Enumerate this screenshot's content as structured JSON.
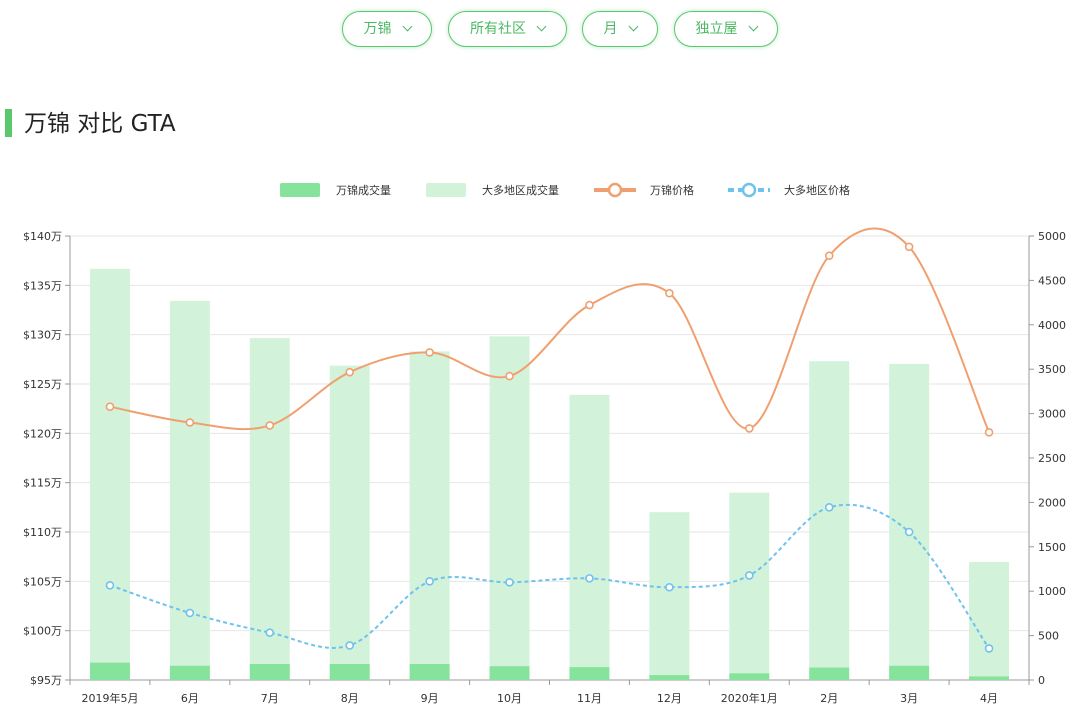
{
  "filters": [
    {
      "label": "万锦"
    },
    {
      "label": "所有社区"
    },
    {
      "label": "月"
    },
    {
      "label": "独立屋"
    }
  ],
  "section_title": "万锦 对比 GTA",
  "colors": {
    "bar_local": "#86e39b",
    "bar_gta": "#d3f2da",
    "line_local": "#f0a070",
    "line_gta": "#6ec2ee",
    "accent": "#5cc86e"
  },
  "chart_data": {
    "type": "bar",
    "categories": [
      "2019年5月",
      "6月",
      "7月",
      "8月",
      "9月",
      "10月",
      "11月",
      "12月",
      "2020年1月",
      "2月",
      "3月",
      "4月"
    ],
    "series": [
      {
        "name": "万锦成交量",
        "type": "bar",
        "axis": "right",
        "values": [
          195,
          160,
          180,
          180,
          180,
          155,
          145,
          55,
          75,
          140,
          160,
          40
        ]
      },
      {
        "name": "大多地区成交量",
        "type": "bar",
        "axis": "right",
        "values": [
          4630,
          4270,
          3850,
          3540,
          3700,
          3870,
          3210,
          1890,
          2110,
          3590,
          3560,
          1330
        ]
      },
      {
        "name": "万锦价格",
        "type": "line",
        "axis": "left",
        "values": [
          122.7,
          121.1,
          120.8,
          126.2,
          128.2,
          125.8,
          133.0,
          134.2,
          120.5,
          138.0,
          138.9,
          120.1
        ]
      },
      {
        "name": "大多地区价格",
        "type": "line",
        "axis": "left",
        "dashed": true,
        "values": [
          104.6,
          101.8,
          99.8,
          98.5,
          105.0,
          104.9,
          105.3,
          104.4,
          105.6,
          112.5,
          110.0,
          98.2
        ]
      }
    ],
    "y_left": {
      "ticks": [
        "$95万",
        "$100万",
        "$105万",
        "$110万",
        "$115万",
        "$120万",
        "$125万",
        "$130万",
        "$135万",
        "$140万"
      ],
      "range": [
        95,
        140
      ]
    },
    "y_right": {
      "ticks": [
        "0",
        "500",
        "1000",
        "1500",
        "2000",
        "2500",
        "3000",
        "3500",
        "4000",
        "4500",
        "5000"
      ],
      "range": [
        0,
        5000
      ]
    },
    "legend_position": "top-center",
    "grid": true
  }
}
